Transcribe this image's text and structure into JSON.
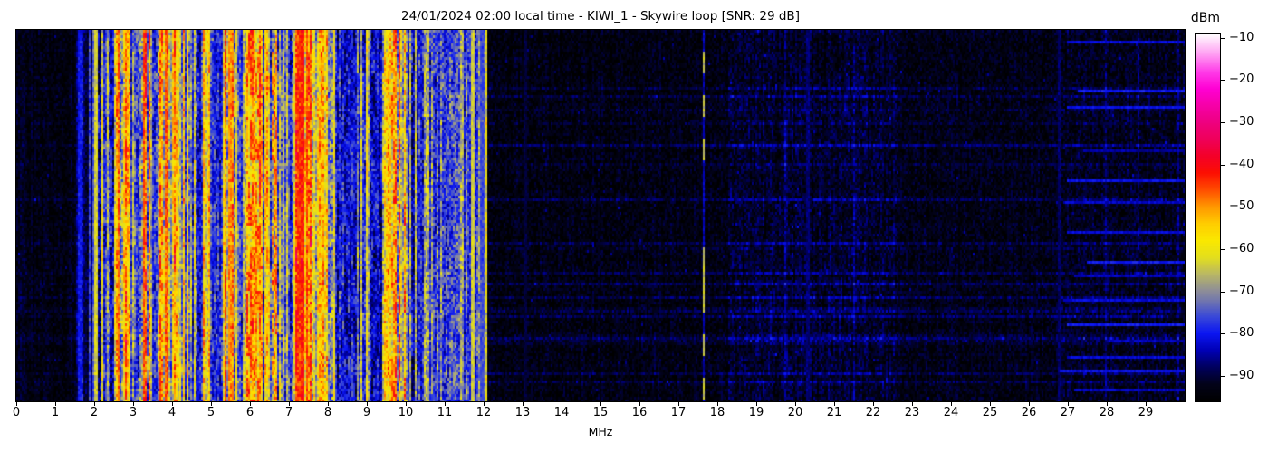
{
  "figure": {
    "background": "#ffffff"
  },
  "chart_data": {
    "type": "heatmap",
    "subtype": "radio-spectrogram-waterfall",
    "title": "24/01/2024 02:00 local time - KIWI_1 - Skywire loop [SNR: 29 dB]",
    "xlabel": "MHz",
    "x_range": [
      0,
      30
    ],
    "x_ticks": [
      "0",
      "1",
      "2",
      "3",
      "4",
      "5",
      "6",
      "7",
      "8",
      "9",
      "10",
      "11",
      "12",
      "13",
      "14",
      "15",
      "16",
      "17",
      "18",
      "19",
      "20",
      "21",
      "22",
      "23",
      "24",
      "25",
      "26",
      "27",
      "28",
      "29"
    ],
    "y_axis_note": "time history, no ticks shown",
    "grid": false,
    "colorbar": {
      "label": "dBm",
      "range": [
        -96,
        -9
      ],
      "ticks": [
        {
          "value": -10,
          "label": "−10"
        },
        {
          "value": -20,
          "label": "−20"
        },
        {
          "value": -30,
          "label": "−30"
        },
        {
          "value": -40,
          "label": "−40"
        },
        {
          "value": -50,
          "label": "−50"
        },
        {
          "value": -60,
          "label": "−60"
        },
        {
          "value": -70,
          "label": "−70"
        },
        {
          "value": -80,
          "label": "−80"
        },
        {
          "value": -90,
          "label": "−90"
        }
      ],
      "stops": [
        [
          -96,
          "#000000"
        ],
        [
          -92,
          "#02021a"
        ],
        [
          -88,
          "#00005e"
        ],
        [
          -84,
          "#0000b6"
        ],
        [
          -80,
          "#0b16f2"
        ],
        [
          -76,
          "#3a49d8"
        ],
        [
          -72,
          "#7579ab"
        ],
        [
          -70,
          "#8d8d99"
        ],
        [
          -66,
          "#b9b765"
        ],
        [
          -62,
          "#e3df1d"
        ],
        [
          -58,
          "#fae800"
        ],
        [
          -54,
          "#ffcd00"
        ],
        [
          -50,
          "#ff9800"
        ],
        [
          -46,
          "#ff4d00"
        ],
        [
          -42,
          "#fc0f02"
        ],
        [
          -38,
          "#f40028"
        ],
        [
          -34,
          "#ef005a"
        ],
        [
          -30,
          "#ee0080"
        ],
        [
          -26,
          "#f600a8"
        ],
        [
          -22,
          "#ff00d4"
        ],
        [
          -18,
          "#ff3ce8"
        ],
        [
          -14,
          "#ff9af2"
        ],
        [
          -9,
          "#ffffff"
        ]
      ]
    },
    "bands": [
      {
        "f0": 0.0,
        "f1": 1.55,
        "base": -93,
        "colVar": 1.5,
        "cellVar": 3,
        "stripeProb": 0.03,
        "stripeMin": -87,
        "stripeMax": -84,
        "patch": 1.5,
        "rowAmp": 0.5
      },
      {
        "f0": 1.55,
        "f1": 1.72,
        "base": -86,
        "colVar": 2,
        "cellVar": 4,
        "stripeProb": 0.5,
        "stripeMin": -82,
        "stripeMax": -78,
        "patch": 2,
        "rowAmp": 0.3
      },
      {
        "f0": 1.72,
        "f1": 1.98,
        "base": -90,
        "colVar": 2,
        "cellVar": 4,
        "stripeProb": 0.15,
        "stripeMin": -80,
        "stripeMax": -72,
        "patch": 2,
        "rowAmp": 0.3
      },
      {
        "f0": 1.98,
        "f1": 2.22,
        "base": -82,
        "colVar": 4,
        "cellVar": 6,
        "stripeProb": 0.35,
        "stripeMin": -72,
        "stripeMax": -58,
        "patch": 5,
        "rowAmp": 0.3
      },
      {
        "f0": 2.22,
        "f1": 2.52,
        "base": -79,
        "colVar": 4,
        "cellVar": 6,
        "stripeProb": 0.4,
        "stripeMin": -70,
        "stripeMax": -58,
        "patch": 5,
        "rowAmp": 0.3
      },
      {
        "f0": 2.52,
        "f1": 2.92,
        "base": -68,
        "colVar": 5,
        "cellVar": 7,
        "stripeProb": 0.55,
        "stripeMin": -60,
        "stripeMax": -46,
        "patch": 6,
        "rowAmp": 0.3
      },
      {
        "f0": 2.92,
        "f1": 3.17,
        "base": -79,
        "colVar": 4,
        "cellVar": 6,
        "stripeProb": 0.3,
        "stripeMin": -70,
        "stripeMax": -60,
        "patch": 5,
        "rowAmp": 0.3
      },
      {
        "f0": 3.17,
        "f1": 3.42,
        "base": -70,
        "colVar": 5,
        "cellVar": 7,
        "stripeProb": 0.5,
        "stripeMin": -62,
        "stripeMax": -46,
        "patch": 6,
        "rowAmp": 0.3
      },
      {
        "f0": 3.42,
        "f1": 3.62,
        "base": -77,
        "colVar": 4,
        "cellVar": 6,
        "stripeProb": 0.4,
        "stripeMin": -68,
        "stripeMax": -58,
        "patch": 5,
        "rowAmp": 0.3
      },
      {
        "f0": 3.62,
        "f1": 4.12,
        "base": -67,
        "colVar": 5,
        "cellVar": 7,
        "stripeProb": 0.6,
        "stripeMin": -60,
        "stripeMax": -45,
        "patch": 6,
        "rowAmp": 0.3
      },
      {
        "f0": 4.12,
        "f1": 4.48,
        "base": -74,
        "colVar": 5,
        "cellVar": 6,
        "stripeProb": 0.45,
        "stripeMin": -66,
        "stripeMax": -54,
        "patch": 5,
        "rowAmp": 0.3
      },
      {
        "f0": 4.48,
        "f1": 4.78,
        "base": -80,
        "colVar": 4,
        "cellVar": 6,
        "stripeProb": 0.3,
        "stripeMin": -70,
        "stripeMax": -60,
        "patch": 5,
        "rowAmp": 0.3
      },
      {
        "f0": 4.78,
        "f1": 5.02,
        "base": -72,
        "colVar": 5,
        "cellVar": 6,
        "stripeProb": 0.5,
        "stripeMin": -64,
        "stripeMax": -52,
        "patch": 5,
        "rowAmp": 0.3
      },
      {
        "f0": 5.02,
        "f1": 5.32,
        "base": -80,
        "colVar": 4,
        "cellVar": 6,
        "stripeProb": 0.3,
        "stripeMin": -70,
        "stripeMax": -62,
        "patch": 5,
        "rowAmp": 0.3
      },
      {
        "f0": 5.32,
        "f1": 5.62,
        "base": -70,
        "colVar": 5,
        "cellVar": 6,
        "stripeProb": 0.5,
        "stripeMin": -62,
        "stripeMax": -48,
        "patch": 6,
        "rowAmp": 0.3
      },
      {
        "f0": 5.62,
        "f1": 5.92,
        "base": -76,
        "colVar": 5,
        "cellVar": 6,
        "stripeProb": 0.4,
        "stripeMin": -66,
        "stripeMax": -56,
        "patch": 5,
        "rowAmp": 0.3
      },
      {
        "f0": 5.92,
        "f1": 6.32,
        "base": -65,
        "colVar": 5,
        "cellVar": 7,
        "stripeProb": 0.6,
        "stripeMin": -58,
        "stripeMax": -44,
        "patch": 6,
        "rowAmp": 0.3
      },
      {
        "f0": 6.32,
        "f1": 6.82,
        "base": -75,
        "colVar": 5,
        "cellVar": 7,
        "stripeProb": 0.45,
        "stripeMin": -66,
        "stripeMax": -50,
        "patch": 6,
        "rowAmp": 0.3
      },
      {
        "f0": 6.82,
        "f1": 7.17,
        "base": -78,
        "colVar": 4,
        "cellVar": 6,
        "stripeProb": 0.35,
        "stripeMin": -68,
        "stripeMax": -58,
        "patch": 5,
        "rowAmp": 0.3
      },
      {
        "f0": 7.17,
        "f1": 7.58,
        "base": -58,
        "colVar": 5,
        "cellVar": 7,
        "stripeProb": 0.65,
        "stripeMin": -52,
        "stripeMax": -38,
        "patch": 6,
        "rowAmp": 0.3
      },
      {
        "f0": 7.58,
        "f1": 8.12,
        "base": -70,
        "colVar": 5,
        "cellVar": 7,
        "stripeProb": 0.5,
        "stripeMin": -62,
        "stripeMax": -50,
        "patch": 6,
        "rowAmp": 0.3
      },
      {
        "f0": 8.12,
        "f1": 9.38,
        "base": -80,
        "colVar": 4,
        "cellVar": 6,
        "stripeProb": 0.18,
        "stripeMin": -70,
        "stripeMax": -58,
        "patch": 5,
        "rowAmp": 0.3
      },
      {
        "f0": 9.38,
        "f1": 10.02,
        "base": -68,
        "colVar": 5,
        "cellVar": 7,
        "stripeProb": 0.55,
        "stripeMin": -60,
        "stripeMax": -47,
        "patch": 6,
        "rowAmp": 0.3
      },
      {
        "f0": 10.02,
        "f1": 10.42,
        "base": -80,
        "colVar": 4,
        "cellVar": 6,
        "stripeProb": 0.25,
        "stripeMin": -72,
        "stripeMax": -62,
        "patch": 5,
        "rowAmp": 0.3
      },
      {
        "f0": 10.42,
        "f1": 11.42,
        "base": -78,
        "colVar": 3,
        "cellVar": 7,
        "stripeProb": 0.3,
        "stripeMin": -73,
        "stripeMax": -65,
        "patch": 4,
        "rowAmp": 0.3
      },
      {
        "f0": 11.42,
        "f1": 12.08,
        "base": -80,
        "colVar": 4,
        "cellVar": 6,
        "stripeProb": 0.35,
        "stripeMin": -72,
        "stripeMax": -60,
        "patch": 4,
        "rowAmp": 0.3
      },
      {
        "f0": 12.08,
        "f1": 18.3,
        "base": -93.5,
        "colVar": 1,
        "cellVar": 3.5,
        "stripeProb": 0,
        "stripeMin": -93,
        "stripeMax": -93,
        "patch": 1,
        "rowAmp": 1.0
      },
      {
        "f0": 18.3,
        "f1": 22.6,
        "base": -91.5,
        "colVar": 1.5,
        "cellVar": 4,
        "stripeProb": 0.02,
        "stripeMin": -88,
        "stripeMax": -86,
        "patch": 2,
        "rowAmp": 1.4
      },
      {
        "f0": 22.6,
        "f1": 26.85,
        "base": -93,
        "colVar": 1,
        "cellVar": 3.5,
        "stripeProb": 0,
        "stripeMin": -93,
        "stripeMax": -93,
        "patch": 1,
        "rowAmp": 1.0
      },
      {
        "f0": 26.85,
        "f1": 30.0,
        "base": -92.5,
        "colVar": 1.2,
        "cellVar": 4,
        "stripeProb": 0.02,
        "stripeMin": -89,
        "stripeMax": -87,
        "patch": 1.5,
        "rowAmp": 1.2
      }
    ],
    "carriers": [
      {
        "f": 1.62,
        "level": -80,
        "w": 2,
        "jitter": 2
      },
      {
        "f": 2.05,
        "level": -63,
        "w": 2,
        "jitter": 3
      },
      {
        "f": 2.62,
        "level": -47,
        "w": 2,
        "jitter": 4
      },
      {
        "f": 3.27,
        "level": -46,
        "w": 2,
        "jitter": 4
      },
      {
        "f": 3.86,
        "level": -47,
        "w": 2,
        "jitter": 4
      },
      {
        "f": 5.5,
        "level": -50,
        "w": 2,
        "jitter": 4
      },
      {
        "f": 6.0,
        "level": -48,
        "w": 2,
        "jitter": 5,
        "dash": 0.5,
        "dashLevel": -46,
        "offLevel": -60
      },
      {
        "f": 6.18,
        "level": -50,
        "w": 2,
        "jitter": 5,
        "dash": 0.5,
        "dashLevel": -48,
        "offLevel": -62
      },
      {
        "f": 6.6,
        "level": -52,
        "w": 2,
        "jitter": 6,
        "dash": 0.55,
        "dashLevel": -50,
        "offLevel": -70
      },
      {
        "f": 7.25,
        "level": -44,
        "w": 2,
        "jitter": 4
      },
      {
        "f": 7.35,
        "level": -42,
        "w": 3,
        "jitter": 4
      },
      {
        "f": 7.47,
        "level": -45,
        "w": 2,
        "jitter": 4
      },
      {
        "f": 9.65,
        "level": -50,
        "w": 2,
        "jitter": 5,
        "dash": 0.45,
        "dashLevel": -48,
        "offLevel": -64
      },
      {
        "f": 11.73,
        "level": -64,
        "w": 2,
        "jitter": 3
      },
      {
        "f": 11.95,
        "level": -76,
        "w": 2,
        "jitter": 2
      },
      {
        "f": 12.02,
        "level": -74,
        "w": 2,
        "jitter": 2
      },
      {
        "f": 13.07,
        "level": -90,
        "w": 2,
        "jitter": 1
      },
      {
        "f": 17.65,
        "level": -78,
        "w": 2,
        "jitter": 2,
        "dash": 0.4,
        "dashLevel": -65,
        "offLevel": -84
      },
      {
        "f": 20.32,
        "level": -87,
        "w": 2,
        "jitter": 1.5
      },
      {
        "f": 26.78,
        "level": -88,
        "w": 2,
        "jitter": 1.5
      }
    ],
    "h_lines": [
      {
        "f0": 27.0,
        "f1": 30.0,
        "yf": 0.03,
        "level": -82
      },
      {
        "f0": 27.3,
        "f1": 30.0,
        "yf": 0.16,
        "level": -80
      },
      {
        "f0": 27.0,
        "f1": 30.0,
        "yf": 0.207,
        "level": -81
      },
      {
        "f0": 27.4,
        "f1": 30.0,
        "yf": 0.327,
        "level": -85
      },
      {
        "f0": 27.0,
        "f1": 30.0,
        "yf": 0.402,
        "level": -81
      },
      {
        "f0": 26.9,
        "f1": 30.0,
        "yf": 0.461,
        "level": -83
      },
      {
        "f0": 27.0,
        "f1": 30.0,
        "yf": 0.541,
        "level": -82
      },
      {
        "f0": 27.5,
        "f1": 30.0,
        "yf": 0.627,
        "level": -80
      },
      {
        "f0": 27.2,
        "f1": 30.0,
        "yf": 0.659,
        "level": -84
      },
      {
        "f0": 26.9,
        "f1": 30.0,
        "yf": 0.729,
        "level": -82
      },
      {
        "f0": 27.0,
        "f1": 30.0,
        "yf": 0.793,
        "level": -80
      },
      {
        "f0": 28.0,
        "f1": 30.0,
        "yf": 0.841,
        "level": -84
      },
      {
        "f0": 27.0,
        "f1": 30.0,
        "yf": 0.883,
        "level": -82
      },
      {
        "f0": 26.8,
        "f1": 30.0,
        "yf": 0.92,
        "level": -81
      },
      {
        "f0": 27.2,
        "f1": 30.0,
        "yf": 0.973,
        "level": -83
      }
    ]
  }
}
